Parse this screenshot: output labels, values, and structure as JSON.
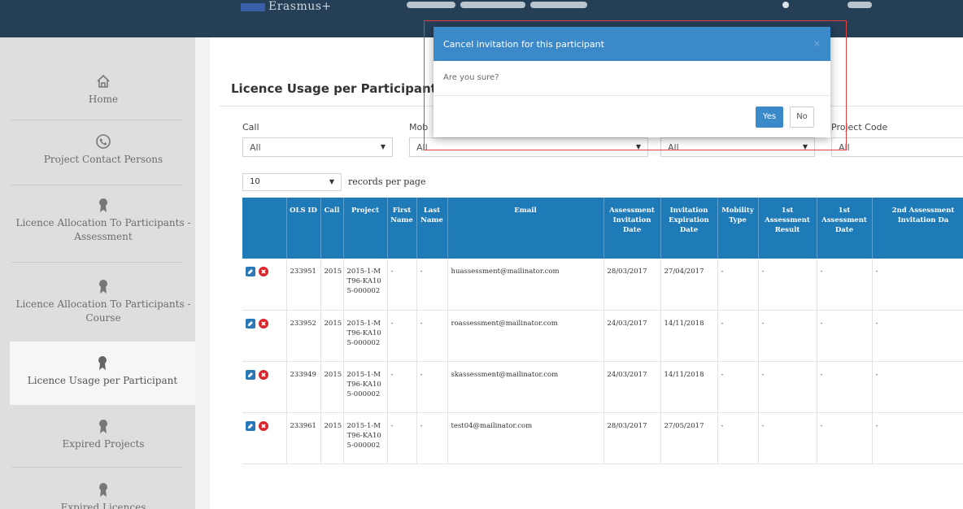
{
  "header": {
    "brand": "Erasmus+",
    "accent": "#253f57"
  },
  "sidebar": {
    "items": [
      {
        "label": "Home",
        "icon": "home-icon"
      },
      {
        "label": "Project Contact Persons",
        "icon": "phone-icon"
      },
      {
        "label": "Licence Allocation To Participants - Assessment",
        "icon": "award-icon"
      },
      {
        "label": "Licence Allocation To Participants - Course",
        "icon": "award-icon"
      },
      {
        "label": "Licence Usage per Participant",
        "icon": "award-icon",
        "active": true
      },
      {
        "label": "Expired Projects",
        "icon": "award-icon"
      },
      {
        "label": "Expired Licences",
        "icon": "award-icon"
      }
    ]
  },
  "panel": {
    "title": "Licence Usage per Participant"
  },
  "filters": {
    "call_label": "Call",
    "call_value": "All",
    "mobility_label": "Mob",
    "mobility_value": "All",
    "third_value": "All",
    "project_code_label": "Project Code",
    "project_code_value": "All"
  },
  "records": {
    "value": "10",
    "label": "records per page"
  },
  "table": {
    "headers": [
      "",
      "OLS ID",
      "Call",
      "Project",
      "First Name",
      "Last Name",
      "Email",
      "Assessment Invitation Date",
      "Invitation Expiration Date",
      "Mobility Type",
      "1st Assessment Result",
      "1st Assessment Date",
      "2nd Assessment Invitation Da"
    ],
    "rows": [
      [
        "",
        "233951",
        "2015",
        "2015-1-MT96-KA105-000002",
        "-",
        "-",
        "huassessment@mailinator.com",
        "28/03/2017",
        "27/04/2017",
        "-",
        "-",
        "-",
        "-"
      ],
      [
        "",
        "233952",
        "2015",
        "2015-1-MT96-KA105-000002",
        "-",
        "-",
        "roassessment@mailinator.com",
        "24/03/2017",
        "14/11/2018",
        "-",
        "-",
        "-",
        "-"
      ],
      [
        "",
        "233949",
        "2015",
        "2015-1-MT96-KA105-000002",
        "-",
        "-",
        "skassessment@mailinator.com",
        "24/03/2017",
        "14/11/2018",
        "-",
        "-",
        "-",
        "-"
      ],
      [
        "",
        "233961",
        "2015",
        "2015-1-MT96-KA105-000002",
        "-",
        "-",
        "test04@mailinator.com",
        "28/03/2017",
        "27/05/2017",
        "-",
        "-",
        "-",
        "-"
      ]
    ]
  },
  "modal": {
    "title": "Cancel invitation for this participant",
    "close": "×",
    "body": "Are you sure?",
    "yes": "Yes",
    "no": "No"
  },
  "colors": {
    "table_header": "#1f7ab8",
    "modal_header": "#3c89c9",
    "edit_icon": "#2a78b8",
    "cancel_icon": "#d9262c"
  }
}
